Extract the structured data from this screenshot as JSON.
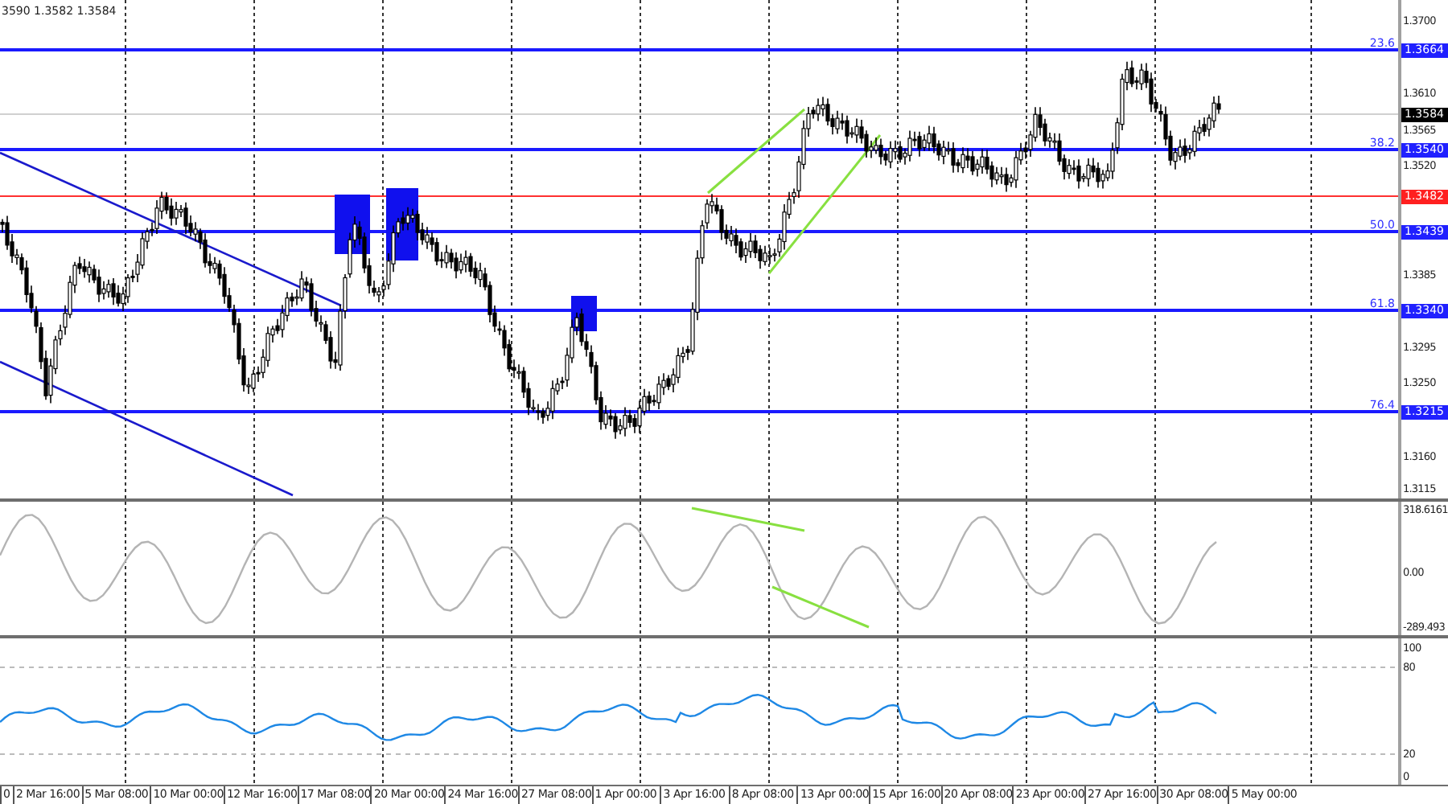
{
  "header": {
    "quote": "3590 1.3582 1.3584"
  },
  "price_axis": {
    "ticks": [
      "1.3700",
      "1.3610",
      "1.3565",
      "1.3520",
      "1.3385",
      "1.3295",
      "1.3250",
      "1.3160",
      "1.3115"
    ]
  },
  "price_levels": [
    {
      "kind": "fibo",
      "ratio": "23.6",
      "badge": "1.3664",
      "color": "#2020ff"
    },
    {
      "kind": "bid",
      "badge": "1.3584",
      "color": "#000000"
    },
    {
      "kind": "fibo",
      "ratio": "38.2",
      "badge": "1.3540",
      "color": "#2020ff"
    },
    {
      "kind": "alert",
      "badge": "1.3482",
      "color": "#ff2020"
    },
    {
      "kind": "fibo",
      "ratio": "50.0",
      "badge": "1.3439",
      "color": "#2020ff"
    },
    {
      "kind": "fibo",
      "ratio": "61.8",
      "badge": "1.3340",
      "color": "#2020ff"
    },
    {
      "kind": "fibo",
      "ratio": "76.4",
      "badge": "1.3215",
      "color": "#2020ff"
    }
  ],
  "cci_axis": {
    "ticks": [
      "318.6161",
      "0.00",
      "-289.493"
    ]
  },
  "rsi_axis": {
    "ticks": [
      "100",
      "80",
      "20",
      "0"
    ]
  },
  "time_axis": {
    "labels": [
      "0",
      "2 Mar 16:00",
      "5 Mar 08:00",
      "10 Mar 00:00",
      "12 Mar 16:00",
      "17 Mar 08:00",
      "20 Mar 00:00",
      "24 Mar 16:00",
      "27 Mar 08:00",
      "1 Apr 00:00",
      "3 Apr 16:00",
      "8 Apr 08:00",
      "13 Apr 00:00",
      "15 Apr 16:00",
      "20 Apr 08:00",
      "23 Apr 00:00",
      "27 Apr 16:00",
      "30 Apr 08:00",
      "5 May 00:00"
    ]
  }
}
